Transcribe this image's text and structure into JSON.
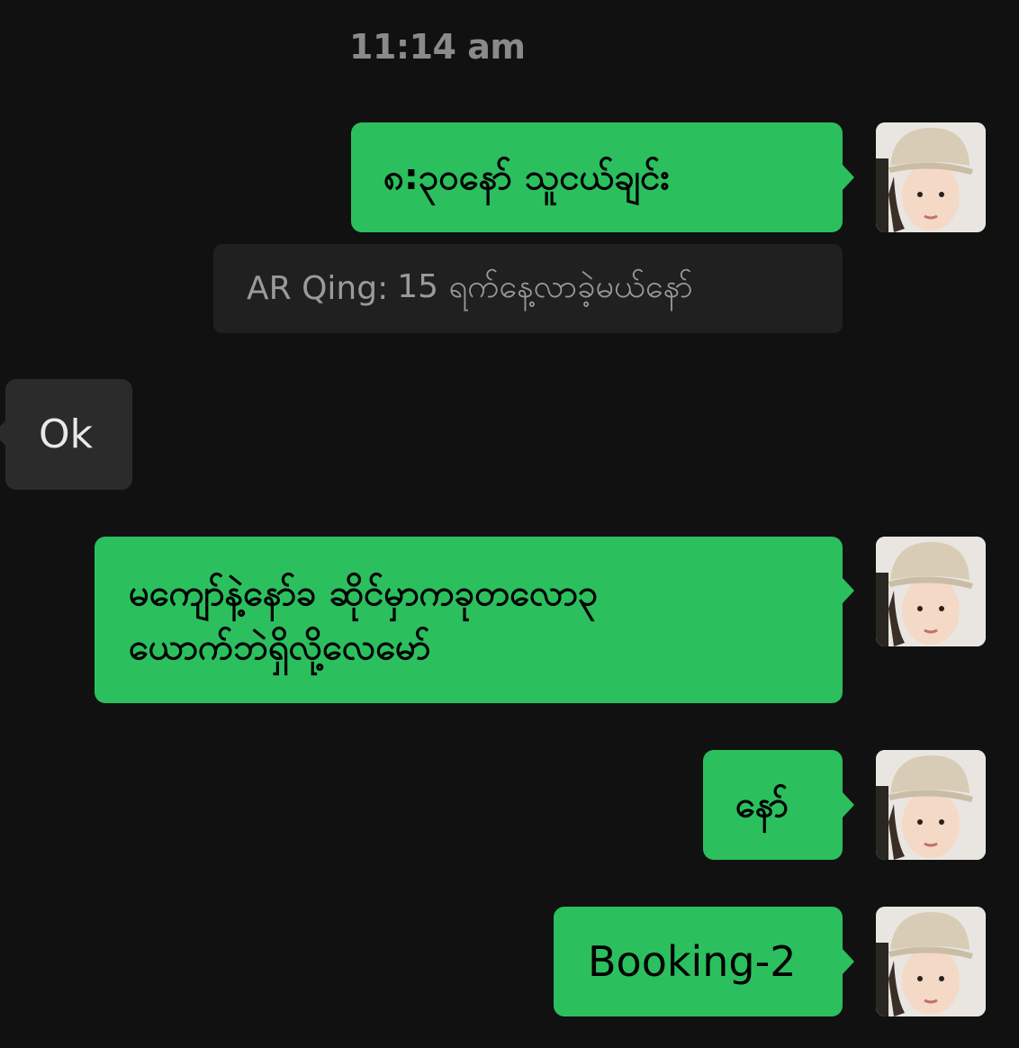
{
  "timestamp": "11:14 am",
  "messages": [
    {
      "id": "m1",
      "direction": "outgoing",
      "text": "၈:၃၀နော် သူငယ်ချင်း"
    },
    {
      "id": "q1",
      "type": "quote",
      "sender": "AR Qing:",
      "text": "15 ရက်နေ့လာခဲ့မယ်နော်"
    },
    {
      "id": "m2",
      "direction": "incoming",
      "text": "Ok"
    },
    {
      "id": "m3",
      "direction": "outgoing",
      "lines": [
        "မကျော်နဲ့နော်ခ ဆိုင်မှာကခုတလော၃",
        "ယောက်ဘဲရှိလို့လေမော်"
      ]
    },
    {
      "id": "m4",
      "direction": "outgoing",
      "text": "နော်"
    },
    {
      "id": "m5",
      "direction": "outgoing",
      "text": "Booking-2"
    }
  ],
  "colors": {
    "background": "#111111",
    "outgoing_bubble": "#2cbf5e",
    "incoming_bubble": "#2b2b2b",
    "quote_bg": "#202020"
  },
  "icons": {
    "avatar": "user-avatar-icon"
  }
}
